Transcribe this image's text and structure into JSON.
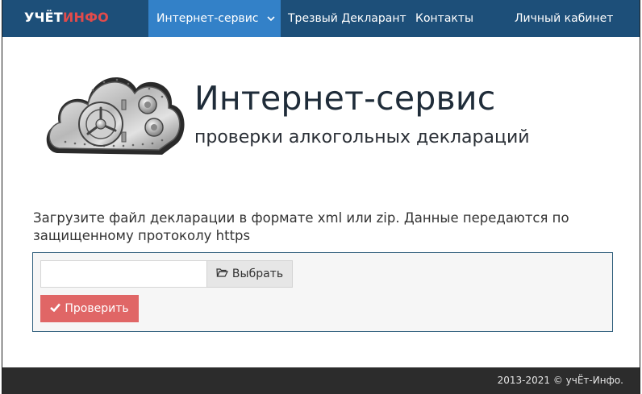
{
  "brand": {
    "part1": "УЧЁТ",
    "part2": "ИНФО"
  },
  "nav": {
    "active_label": "Интернет-сервис",
    "sober_label": "Трезвый Декларант",
    "contacts_label": "Контакты",
    "cabinet_label": "Личный кабинет"
  },
  "hero": {
    "title": "Интернет-сервис",
    "subtitle": "проверки алкогольных деклараций",
    "icon": "cloud-vault-icon"
  },
  "upload": {
    "instruction": "Загрузите файл декларации в формате xml или zip. Данные передаются по защищенному протоколу https",
    "file_value": "",
    "pick_label": "Выбрать",
    "check_label": "Проверить"
  },
  "footer": {
    "text": "2013-2021 © учЁт-Инфо."
  },
  "colors": {
    "navbar": "#1d4f79",
    "nav_active": "#3381c8",
    "brand_accent": "#e24b4b",
    "check_button": "#e06666",
    "footer": "#2c2c2c"
  }
}
